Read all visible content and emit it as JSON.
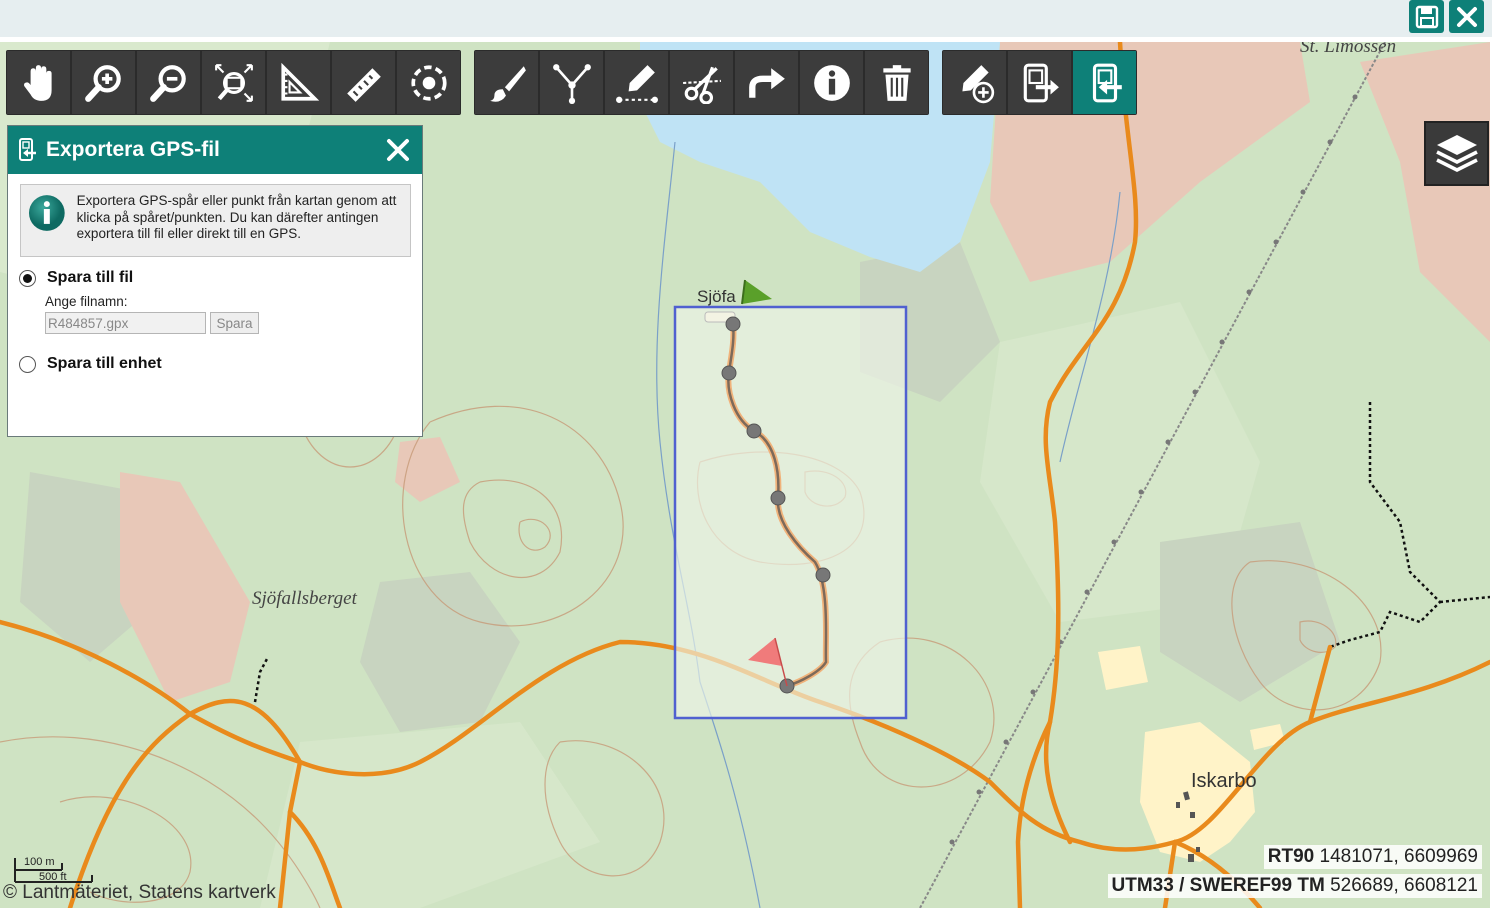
{
  "topbar": {
    "save_icon": "floppy-disk-icon",
    "close_icon": "close-icon",
    "accent_color": "#0e8078"
  },
  "toolbar": {
    "group1": [
      "pan-hand-icon",
      "zoom-in-icon",
      "zoom-out-icon",
      "zoom-extent-icon",
      "measure-area-icon",
      "measure-distance-icon",
      "radius-icon"
    ],
    "group2": [
      "draw-brush-icon",
      "split-line-icon",
      "edit-line-icon",
      "cut-scissors-icon",
      "redo-arrow-icon",
      "info-icon",
      "delete-trash-icon"
    ],
    "group3": [
      "add-gps-point-icon",
      "import-gps-icon",
      "export-gps-icon"
    ],
    "active_tool": "export-gps-icon"
  },
  "layers_button": {
    "icon": "layers-icon"
  },
  "panel": {
    "title": "Exportera GPS-fil",
    "info_text": "Exportera GPS-spår eller punkt från kartan genom att klicka på spåret/punkten. Du kan därefter antingen exportera till fil eller direkt till en GPS.",
    "option_file": "Spara till fil",
    "option_file_selected": true,
    "filename_label": "Ange filnamn:",
    "filename_value": "R484857.gpx",
    "save_button": "Spara",
    "option_device": "Spara till enhet",
    "option_device_selected": false
  },
  "map": {
    "places": {
      "sjofallsberget": "Sjöfallsberget",
      "sjofa": "Sjöfa",
      "iskarbo": "Iskarbo",
      "st_limossen": "St. Limossen"
    },
    "scale": {
      "metric": "100 m",
      "imperial": "500 ft"
    },
    "attribution": "© Lantmäteriet, Statens kartverk",
    "coords": [
      {
        "system": "RT90",
        "value": "1481071, 6609969"
      },
      {
        "system": "UTM33 / SWEREF99 TM",
        "value": "526689, 6608121"
      }
    ],
    "colors": {
      "forest": "#cfe3c3",
      "water": "#bfe3f5",
      "road": "#e98a1c",
      "selection": "#5060d0",
      "track": "#8a6a4a"
    }
  }
}
